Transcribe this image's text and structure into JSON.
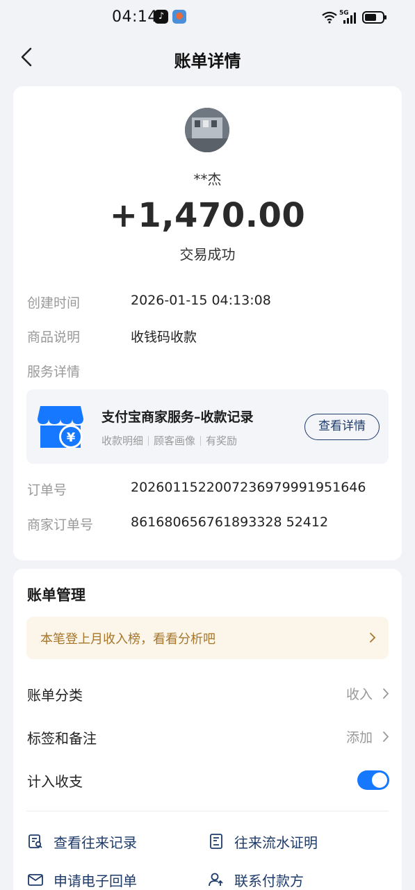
{
  "status_bar": {
    "time": "04:14",
    "network": "5G",
    "tiktok_glyph": "♪"
  },
  "nav": {
    "title": "账单详情"
  },
  "bill": {
    "counterparty": "**杰",
    "amount": "+1,470.00",
    "status": "交易成功",
    "created_label": "创建时间",
    "created_value": "2026-01-15 04:13:08",
    "desc_label": "商品说明",
    "desc_value": "收钱码收款",
    "service_label": "服务详情",
    "service": {
      "title": "支付宝商家服务–收款记录",
      "sub_items": [
        "收款明细",
        "顾客画像",
        "有奖励"
      ],
      "button": "查看详情"
    },
    "order_label": "订单号",
    "order_value": "2026011522007236979991951646",
    "merchant_order_label": "商家订单号",
    "merchant_order_value": "861680656761893328 52412"
  },
  "management": {
    "title": "账单管理",
    "promo": "本笔登上月收入榜，看看分析吧",
    "category_label": "账单分类",
    "category_value": "收入",
    "tags_label": "标签和备注",
    "tags_value": "添加",
    "include_label": "计入收支",
    "include_on": true,
    "actions": {
      "history": "查看往来记录",
      "proof": "往来流水证明",
      "receipt": "申请电子回单",
      "contact": "联系付款方"
    }
  },
  "colors": {
    "accent": "#1677ff",
    "navy": "#1e3b6a",
    "promo_text": "#a6762a",
    "promo_bg": "#fbf5ea"
  }
}
